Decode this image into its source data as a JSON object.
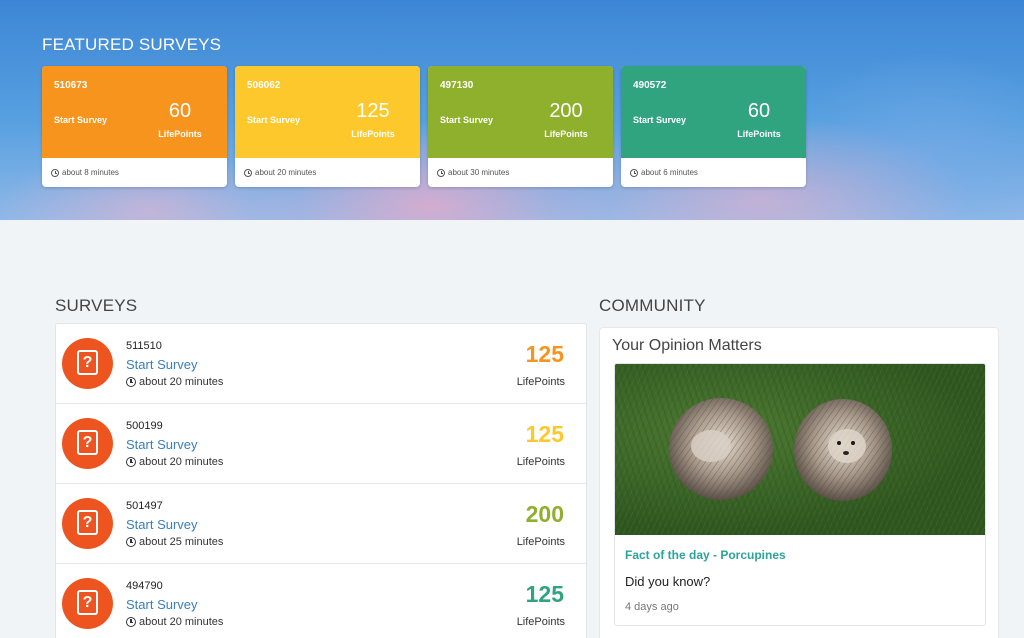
{
  "featured": {
    "title": "FEATURED SURVEYS",
    "cards": [
      {
        "id": "510673",
        "start": "Start Survey",
        "points": "60",
        "unit": "LifePoints",
        "time": "about 8 minutes",
        "color": "#f7941d"
      },
      {
        "id": "506062",
        "start": "Start Survey",
        "points": "125",
        "unit": "LifePoints",
        "time": "about 20 minutes",
        "color": "#fcc82c"
      },
      {
        "id": "497130",
        "start": "Start Survey",
        "points": "200",
        "unit": "LifePoints",
        "time": "about 30 minutes",
        "color": "#8fb02d"
      },
      {
        "id": "490572",
        "start": "Start Survey",
        "points": "60",
        "unit": "LifePoints",
        "time": "about 6 minutes",
        "color": "#2fa47e"
      }
    ]
  },
  "surveys": {
    "title": "SURVEYS",
    "icon": "question-icon",
    "icon_color": "#ee5420",
    "rows": [
      {
        "id": "511510",
        "start": "Start Survey",
        "time": "about 20 minutes",
        "points": "125",
        "unit": "LifePoints",
        "color": "#f7941d"
      },
      {
        "id": "500199",
        "start": "Start Survey",
        "time": "about 20 minutes",
        "points": "125",
        "unit": "LifePoints",
        "color": "#fcc82c"
      },
      {
        "id": "501497",
        "start": "Start Survey",
        "time": "about 25 minutes",
        "points": "200",
        "unit": "LifePoints",
        "color": "#8fb02d"
      },
      {
        "id": "494790",
        "start": "Start Survey",
        "time": "about 20 minutes",
        "points": "125",
        "unit": "LifePoints",
        "color": "#2fa47e"
      }
    ]
  },
  "community": {
    "title": "COMMUNITY",
    "card_title": "Your Opinion Matters",
    "article": {
      "title": "Fact of the day - Porcupines",
      "lead": "Did you know?",
      "date": "4 days ago"
    }
  },
  "colors": {
    "link": "#3a7fb8",
    "teal": "#2aa39a"
  }
}
